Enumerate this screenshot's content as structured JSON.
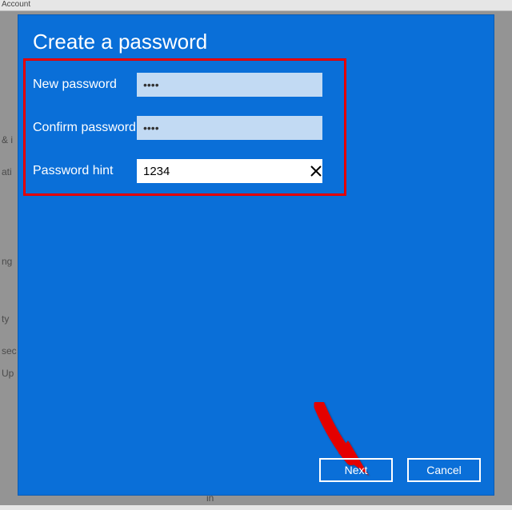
{
  "background": {
    "header": "Account",
    "sideHints": [
      "& i",
      "ati",
      "ng",
      "ty",
      "sec",
      "Up",
      "in"
    ]
  },
  "dialog": {
    "title": "Create a password",
    "fields": {
      "newPassword": {
        "label": "New password",
        "value": "••••"
      },
      "confirmPassword": {
        "label": "Confirm password",
        "value": "••••"
      },
      "hint": {
        "label": "Password hint",
        "value": "1234"
      }
    },
    "buttons": {
      "next": "Next",
      "cancel": "Cancel"
    }
  }
}
